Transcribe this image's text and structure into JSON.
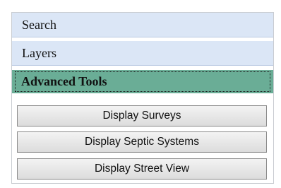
{
  "accordion": {
    "sections": [
      {
        "label": "Search"
      },
      {
        "label": "Layers"
      },
      {
        "label": "Advanced Tools",
        "expanded": true,
        "focused": true
      }
    ]
  },
  "advanced_tools": {
    "buttons": [
      {
        "label": "Display Surveys",
        "highlighted": true
      },
      {
        "label": "Display Septic Systems"
      },
      {
        "label": "Display Street View"
      }
    ]
  },
  "colors": {
    "header_bg": "#dbe6f6",
    "active_header_bg": "#6aad96",
    "highlight": "#f7f32a",
    "button_border": "#8a8a8a"
  }
}
